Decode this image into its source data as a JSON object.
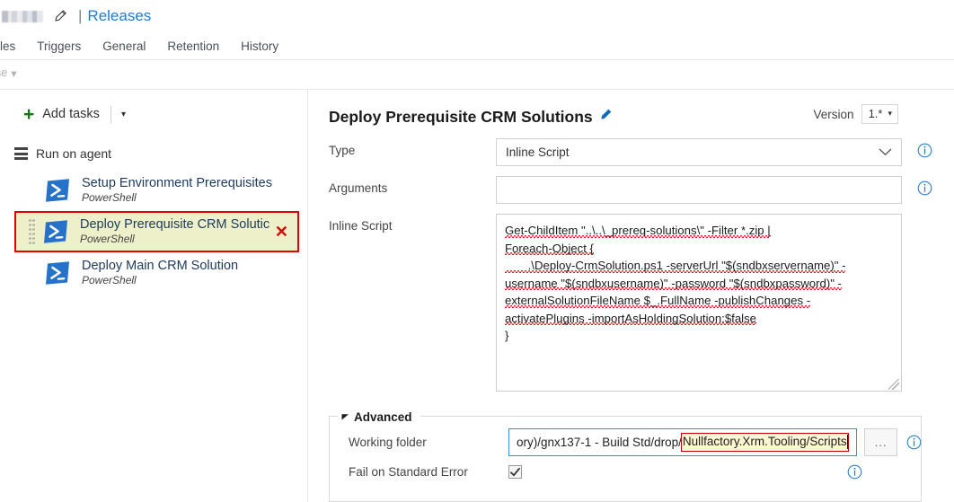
{
  "topbar": {
    "redacted_title": "",
    "edit_icon": "pencil-icon",
    "separator": "|",
    "releases_link": "Releases"
  },
  "tabs": [
    {
      "label": "iables"
    },
    {
      "label": "Triggers"
    },
    {
      "label": "General"
    },
    {
      "label": "Retention"
    },
    {
      "label": "History"
    }
  ],
  "subrow": {
    "label": "se",
    "caret": "▾"
  },
  "sidebar": {
    "add_tasks": {
      "plus": "+",
      "label": "Add tasks",
      "caret": "▾"
    },
    "phase": {
      "icon": "server-icon",
      "label": "Run on agent"
    },
    "tasks": [
      {
        "name": "Setup Environment Prerequisites",
        "subtitle": "PowerShell",
        "icon": "powershell-icon",
        "selected": false
      },
      {
        "name": "Deploy Prerequisite CRM Solutic",
        "subtitle": "PowerShell",
        "icon": "powershell-icon",
        "selected": true,
        "remove_glyph": "✕"
      },
      {
        "name": "Deploy Main CRM Solution",
        "subtitle": "PowerShell",
        "icon": "powershell-icon",
        "selected": false
      }
    ]
  },
  "detail": {
    "title": "Deploy Prerequisite CRM Solutions",
    "edit_icon": "pencil-icon",
    "version_label": "Version",
    "version_value": "1.*",
    "version_caret": "▾",
    "fields": {
      "type_label": "Type",
      "type_value": "Inline Script",
      "arguments_label": "Arguments",
      "arguments_value": "",
      "inline_script_label": "Inline Script"
    },
    "script_lines": [
      "Get-ChildItem \"..\\..\\_prereq-solutions\\\" -Filter *.zip |",
      "Foreach-Object {",
      "       .\\Deploy-CrmSolution.ps1 -serverUrl \"$(sndbxservername)\" -",
      "username \"$(sndbxusername)\" -password \"$(sndbxpassword)\" -",
      "externalSolutionFileName $_.FullName -publishChanges -",
      "activatePlugins -importAsHoldingSolution:$false",
      "}"
    ],
    "info_icon": "info-icon"
  },
  "advanced": {
    "legend": "Advanced",
    "collapse_icon": "triangle-collapse-icon",
    "working_folder_label": "Working folder",
    "working_folder_prefix": "ory)/gnx137-1 - Build Std/drop/",
    "working_folder_highlight": "Nullfactory.Xrm.Tooling/Scripts",
    "browse_label": "...",
    "fail_on_error_label": "Fail on Standard Error",
    "fail_on_error_checked": true,
    "info_icon": "info-icon"
  },
  "colors": {
    "link_blue": "#1e7bd6",
    "accent_green": "#107c10",
    "powershell_blue": "#2672c8",
    "selection_border": "#e00000",
    "selection_bg": "#eef0c9",
    "highlight_bg": "#fdf6cf",
    "highlight_border": "#c00000",
    "focus_border": "#3b8fd4",
    "info_blue": "#0a66c2"
  }
}
